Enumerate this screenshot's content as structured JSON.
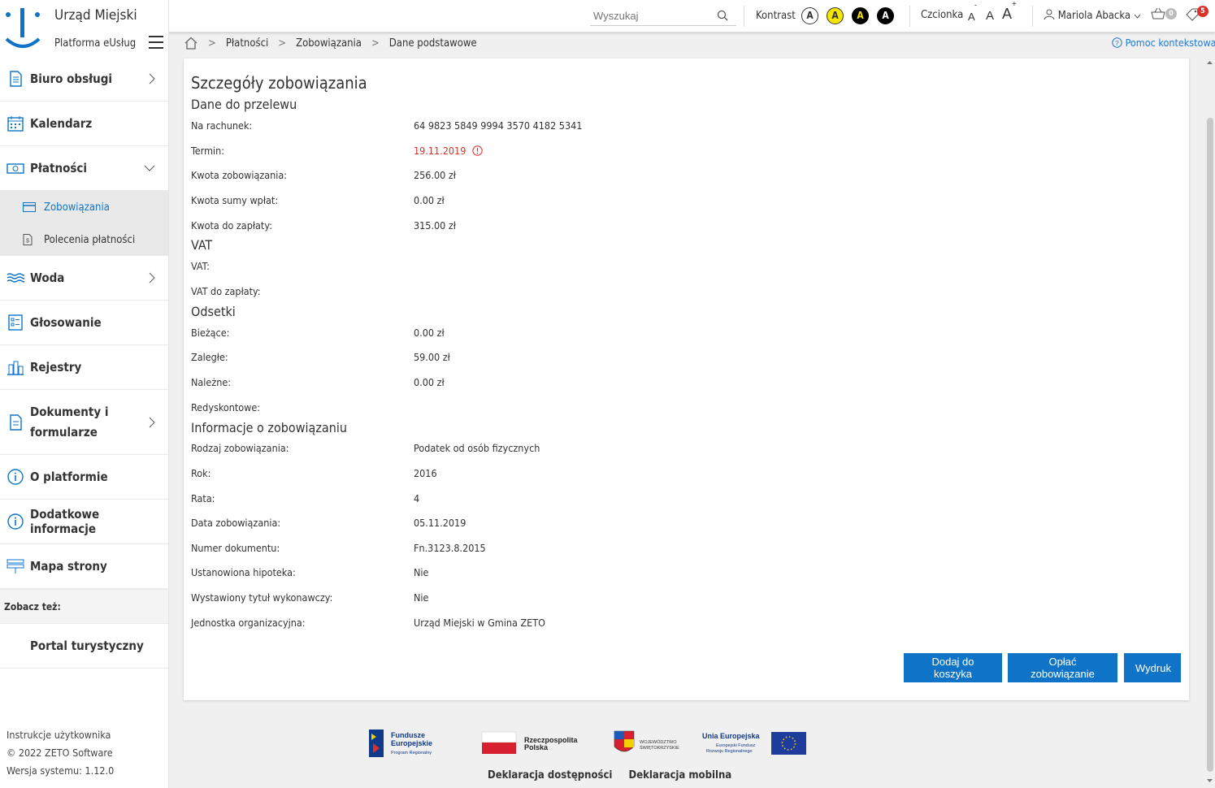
{
  "header": {
    "title": "Urząd Miejski",
    "subtitle": "Platforma eUsług",
    "search_placeholder": "Wyszukaj",
    "contrast_label": "Kontrast",
    "contrast_options": [
      "A",
      "A",
      "A",
      "A"
    ],
    "font_label": "Czcionka",
    "font_sizes": [
      "A",
      "A",
      "A"
    ],
    "font_small_mark": "-",
    "font_large_mark": "+",
    "user_name": "Mariola Abacka",
    "cart_count": "0",
    "notifications_count": "5"
  },
  "sidebar": {
    "items": [
      {
        "label": "Biuro obsługi"
      },
      {
        "label": "Kalendarz"
      },
      {
        "label": "Płatności"
      },
      {
        "label": "Woda"
      },
      {
        "label": "Głosowanie"
      },
      {
        "label": "Rejestry"
      },
      {
        "label": "Dokumenty i formularze"
      },
      {
        "label": "O platformie"
      },
      {
        "label": "Dodatkowe informacje"
      },
      {
        "label": "Mapa strony"
      }
    ],
    "payments_sub": [
      {
        "label": "Zobowiązania"
      },
      {
        "label": "Polecenia płatności"
      }
    ],
    "see_also": "Zobacz też:",
    "portal": "Portal turystyczny",
    "footer": {
      "manual": "Instrukcje użytkownika",
      "copyright": "© 2022 ZETO Software",
      "version": "Wersja systemu: 1.12.0"
    }
  },
  "breadcrumb": [
    "Płatności",
    "Zobowiązania",
    "Dane podstawowe"
  ],
  "help": "Pomoc kontekstowa",
  "main": {
    "title": "Szczegóły zobowiązania",
    "sections": {
      "transfer": "Dane do przelewu",
      "vat": "VAT",
      "interest": "Odsetki",
      "info": "Informacje o zobowiązaniu"
    },
    "transfer": [
      {
        "label": "Na rachunek:",
        "value": "64 9823 5849 9994 3570 4182 5341"
      },
      {
        "label": "Termin:",
        "value": "19.11.2019"
      },
      {
        "label": "Kwota zobowiązania:",
        "value": "256.00 zł"
      },
      {
        "label": "Kwota sumy wpłat:",
        "value": "0.00 zł"
      },
      {
        "label": "Kwota do zapłaty:",
        "value": "315.00 zł"
      }
    ],
    "vat": [
      {
        "label": "VAT:",
        "value": ""
      },
      {
        "label": "VAT do zapłaty:",
        "value": ""
      }
    ],
    "interest": [
      {
        "label": "Bieżące:",
        "value": "0.00 zł"
      },
      {
        "label": "Zaległe:",
        "value": "59.00 zł"
      },
      {
        "label": "Należne:",
        "value": "0.00 zł"
      },
      {
        "label": "Redyskontowe:",
        "value": ""
      }
    ],
    "info": [
      {
        "label": "Rodzaj zobowiązania:",
        "value": "Podatek od osób fizycznych"
      },
      {
        "label": "Rok:",
        "value": "2016"
      },
      {
        "label": "Rata:",
        "value": "4"
      },
      {
        "label": "Data zobowiązania:",
        "value": "05.11.2019"
      },
      {
        "label": "Numer dokumentu:",
        "value": "Fn.3123.8.2015"
      },
      {
        "label": "Ustanowiona hipoteka:",
        "value": "Nie"
      },
      {
        "label": "Wystawiony tytuł wykonawczy:",
        "value": "Nie"
      },
      {
        "label": "Jednostka organizacyjna:",
        "value": "Urząd Miejski w Gmina ZETO"
      }
    ],
    "buttons": {
      "add_to_cart": "Dodaj do koszyka",
      "pay": "Opłać zobowiązanie",
      "print": "Wydruk"
    }
  },
  "footer": {
    "logos": {
      "fe_line1": "Fundusze",
      "fe_line2": "Europejskie",
      "fe_line3": "Program Regionalny",
      "rp_line1": "Rzeczpospolita",
      "rp_line2": "Polska",
      "ws_line1": "WOJEWÓDZTWO",
      "ws_line2": "ŚWIĘTOKRZYSKIE",
      "ue_line1": "Unia Europejska",
      "ue_line2": "Europejski Fundusz",
      "ue_line3": "Rozwoju Regionalnego"
    },
    "links": [
      "Deklaracja dostępności",
      "Deklaracja mobilna"
    ]
  },
  "colors": {
    "accent": "#0f74c8",
    "due_date": "#d9302a",
    "link": "#1e7bd6"
  }
}
